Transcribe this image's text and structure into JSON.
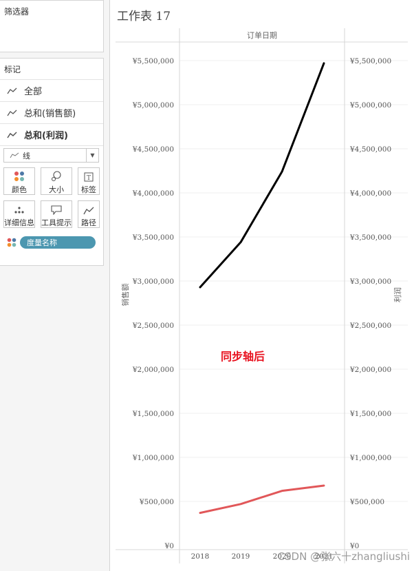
{
  "sidebar": {
    "filters_title": "筛选器",
    "marks_title": "标记",
    "mark_rows": [
      {
        "label": "全部"
      },
      {
        "label": "总和(销售额)"
      },
      {
        "label": "总和(利润)"
      }
    ],
    "mark_type": "线",
    "buttons": [
      {
        "label": "颜色",
        "icon": "color-dots-icon"
      },
      {
        "label": "大小",
        "icon": "size-icon"
      },
      {
        "label": "标签",
        "icon": "label-icon"
      },
      {
        "label": "详细信息",
        "icon": "detail-icon"
      },
      {
        "label": "工具提示",
        "icon": "tooltip-icon"
      },
      {
        "label": "路径",
        "icon": "path-icon"
      }
    ],
    "measure_pill": "度量名称"
  },
  "sheet": {
    "title": "工作表 17"
  },
  "chart_data": {
    "type": "line",
    "header": "订单日期",
    "categories": [
      "2018",
      "2019",
      "2020",
      "2021"
    ],
    "y_label_left": "销售额",
    "y_label_right": "利润",
    "ylim": [
      0,
      5800000
    ],
    "yticks": [
      "¥0",
      "¥500,000",
      "¥1,000,000",
      "¥1,500,000",
      "¥2,000,000",
      "¥2,500,000",
      "¥3,000,000",
      "¥3,500,000",
      "¥4,000,000",
      "¥4,500,000",
      "¥5,000,000",
      "¥5,500,000"
    ],
    "ytick_values": [
      0,
      500000,
      1000000,
      1500000,
      2000000,
      2500000,
      3000000,
      3500000,
      4000000,
      4500000,
      5000000,
      5500000
    ],
    "series": [
      {
        "values": [
          2930000,
          3440000,
          4240000,
          5470000
        ],
        "color": "#000000"
      },
      {
        "values": [
          370000,
          470000,
          620000,
          680000
        ],
        "color": "#e15759"
      }
    ],
    "annotation": "同步轴后",
    "annotation_color": "#e8121f",
    "grid": true
  },
  "watermark": "CSDN @张六十zhangliushi"
}
